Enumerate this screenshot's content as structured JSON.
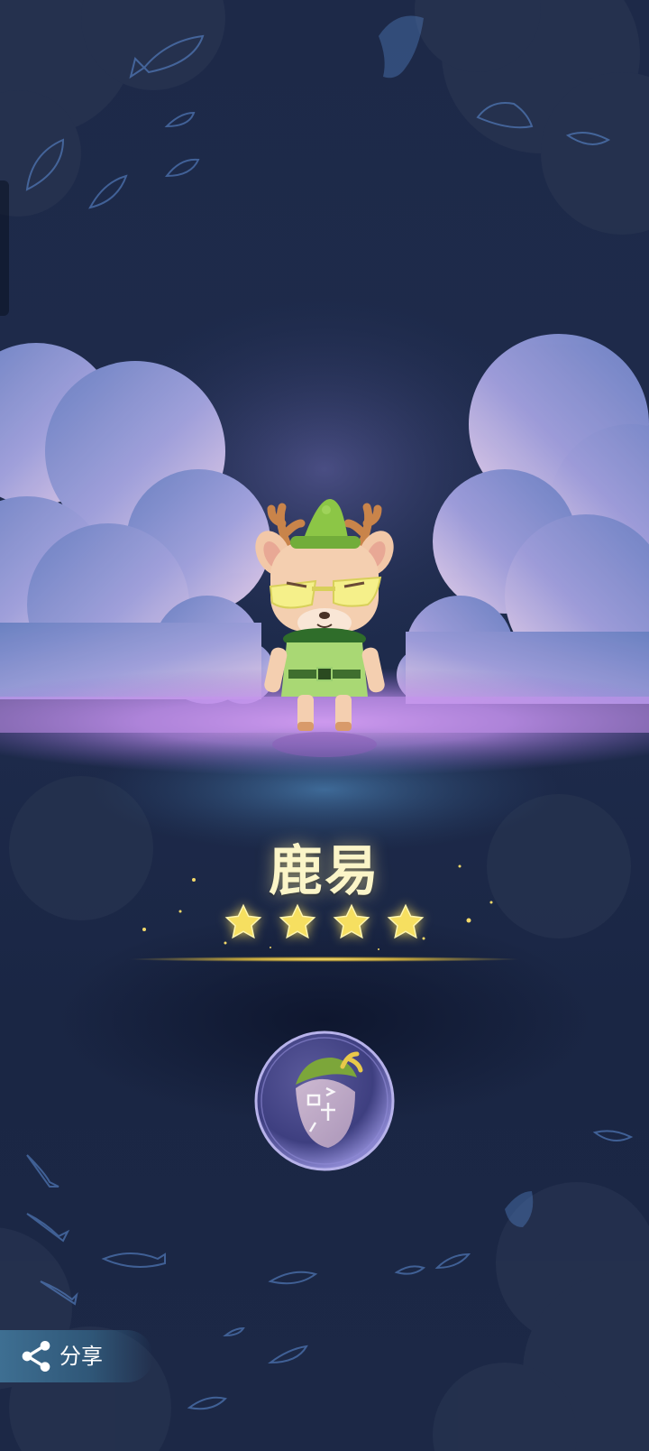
{
  "character": {
    "name": "鹿易",
    "stars": 4
  },
  "badge": {
    "icon": "acorn-icon"
  },
  "share": {
    "label": "分享",
    "icon": "share-icon"
  },
  "colors": {
    "background": "#1d2948",
    "name_text": "#fbf5c8",
    "star": "#f4dc5a",
    "glow_band": "#c98ff0",
    "share_button": "#3e6f92"
  }
}
